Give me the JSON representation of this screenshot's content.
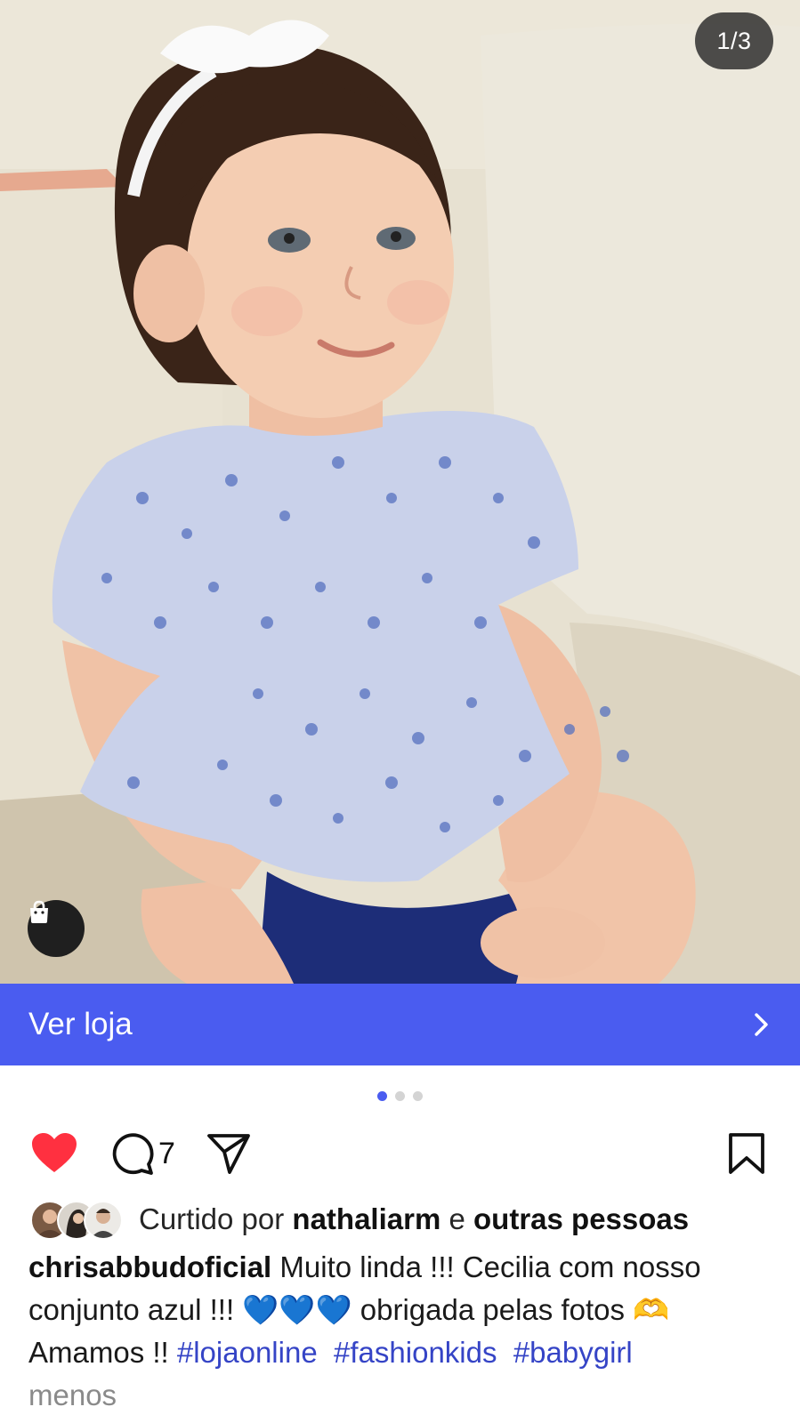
{
  "post": {
    "image_counter": "1/3",
    "shop_banner": {
      "label": "Ver loja",
      "chevron_icon": "chevron-right-icon"
    },
    "shopping_icon": "shopping-bag-icon",
    "carousel": {
      "total": 3,
      "active_index": 0
    },
    "actions": {
      "like_icon": "heart-filled-icon",
      "liked": true,
      "comment_icon": "comment-icon",
      "comment_count": "7",
      "share_icon": "send-icon",
      "save_icon": "bookmark-icon"
    },
    "likes": {
      "prefix": "Curtido por",
      "user": "nathaliarm",
      "connector": "e",
      "others": "outras pessoas"
    },
    "caption": {
      "username": "chrisabbudoficial",
      "text_1": "Muito linda !!! Cecilia com nosso conjunto azul !!!",
      "emoji_hearts": "💙💙💙",
      "text_2": "obrigada pelas fotos",
      "emoji_heart_hands": "🫶",
      "text_3": "Amamos !!",
      "hashtags": [
        "#lojaonline",
        "#fashionkids",
        "#babygirl"
      ],
      "less_label": "menos"
    }
  },
  "colors": {
    "accent": "#4a5cf0",
    "like": "#ff3040",
    "hashtag": "#3544c6"
  }
}
